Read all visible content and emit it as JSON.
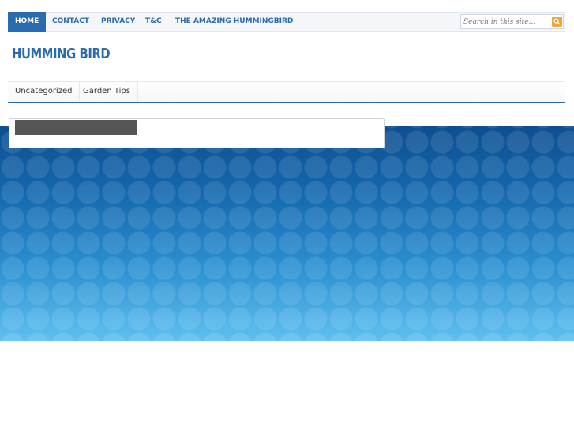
{
  "nav": {
    "items": [
      {
        "label": "HOME",
        "active": true
      },
      {
        "label": "CONTACT",
        "active": false
      },
      {
        "label": "PRIVACY",
        "active": false
      },
      {
        "label": "T&C",
        "active": false
      },
      {
        "label": "THE AMAZING HUMMINGBIRD",
        "active": false
      }
    ]
  },
  "search": {
    "placeholder": "Search in this site...",
    "icon": "search-icon"
  },
  "site": {
    "title": "HUMMING BIRD"
  },
  "categories": [
    {
      "label": "Uncategorized"
    },
    {
      "label": "Garden Tips"
    }
  ],
  "colors": {
    "accent": "#2a6bb0",
    "search_button": "#f0a43c",
    "band_top": "#0d4f91",
    "band_bottom": "#5ec0f0"
  }
}
